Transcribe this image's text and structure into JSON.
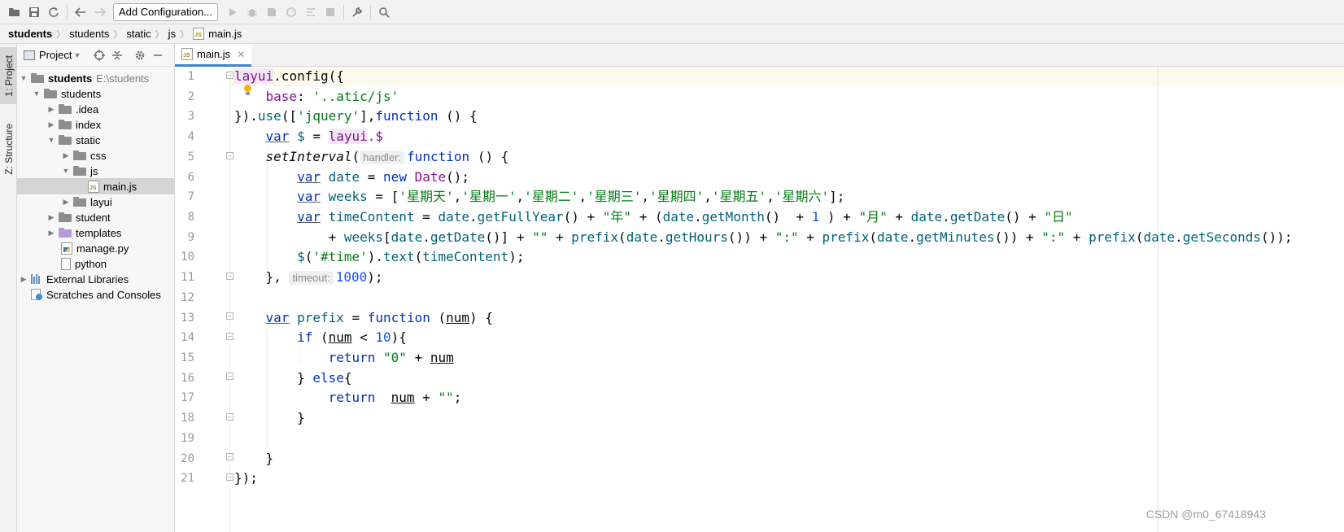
{
  "toolbar": {
    "config_label": "Add Configuration...",
    "icons": [
      "open-folder-icon",
      "save-icon",
      "sync-icon",
      "back-icon",
      "forward-icon",
      "run-icon",
      "debug-icon",
      "coverage-icon",
      "profile-icon",
      "concurrency-icon",
      "stop-icon",
      "settings-wrench-icon",
      "search-icon"
    ]
  },
  "breadcrumb": [
    "students",
    "students",
    "static",
    "js",
    "main.js"
  ],
  "side_tabs": {
    "project": "1: Project",
    "structure": "Z: Structure"
  },
  "project_panel": {
    "title": "Project",
    "tree": [
      {
        "label": "students",
        "note": "E:\\students",
        "level": 0,
        "expanded": true,
        "kind": "folder-root"
      },
      {
        "label": "students",
        "level": 1,
        "expanded": true,
        "kind": "folder"
      },
      {
        "label": ".idea",
        "level": 2,
        "expanded": false,
        "kind": "folder"
      },
      {
        "label": "index",
        "level": 2,
        "expanded": false,
        "kind": "folder"
      },
      {
        "label": "static",
        "level": 2,
        "expanded": true,
        "kind": "folder"
      },
      {
        "label": "css",
        "level": 3,
        "expanded": false,
        "kind": "folder"
      },
      {
        "label": "js",
        "level": 3,
        "expanded": true,
        "kind": "folder"
      },
      {
        "label": "main.js",
        "level": 4,
        "kind": "js-file",
        "selected": true
      },
      {
        "label": "layui",
        "level": 3,
        "expanded": false,
        "kind": "folder"
      },
      {
        "label": "student",
        "level": 2,
        "expanded": false,
        "kind": "folder"
      },
      {
        "label": "templates",
        "level": 2,
        "expanded": false,
        "kind": "folder-purple"
      },
      {
        "label": "manage.py",
        "level": 2,
        "kind": "py-file"
      },
      {
        "label": "python",
        "level": 2,
        "kind": "plain-file"
      },
      {
        "label": "External Libraries",
        "level": 0,
        "expanded": false,
        "kind": "libraries"
      },
      {
        "label": "Scratches and Consoles",
        "level": 0,
        "kind": "scratches"
      }
    ]
  },
  "editor": {
    "tab_label": "main.js",
    "line_numbers": [
      "1",
      "2",
      "3",
      "4",
      "5",
      "6",
      "7",
      "8",
      "9",
      "10",
      "11",
      "12",
      "13",
      "14",
      "15",
      "16",
      "17",
      "18",
      "19",
      "20",
      "21"
    ],
    "code": {
      "l1": [
        "layui",
        ".config({"
      ],
      "l2": [
        "base",
        ": ",
        "'..atic/js'"
      ],
      "l3": [
        "}).",
        "use",
        "([",
        "'jquery'",
        "],",
        "function",
        " () {"
      ],
      "l4": [
        "var",
        " ",
        "$",
        " = ",
        "layui",
        ".$"
      ],
      "l5": [
        "setInterval",
        "(",
        "handler:",
        "function",
        " () {"
      ],
      "l6": [
        "var",
        " ",
        "date",
        " = ",
        "new",
        " ",
        "Date",
        "();"
      ],
      "l7": [
        "var",
        " ",
        "weeks",
        " = [",
        "'星期天'",
        ",",
        "'星期一'",
        ",",
        "'星期二'",
        ",",
        "'星期三'",
        ",",
        "'星期四'",
        ",",
        "'星期五'",
        ",",
        "'星期六'",
        "];"
      ],
      "l8": [
        "var",
        " ",
        "timeContent",
        " = ",
        "date",
        ".",
        "getFullYear",
        "() + ",
        "\"年\"",
        " + (",
        "date",
        ".",
        "getMonth",
        "()  + ",
        "1",
        " ) + ",
        "\"月\"",
        " + ",
        "date",
        ".",
        "getDate",
        "() + ",
        "\"日\""
      ],
      "l9": [
        "+ ",
        "weeks",
        "[",
        "date",
        ".",
        "getDate",
        "()] + ",
        "\"\"",
        " + ",
        "prefix",
        "(",
        "date",
        ".",
        "getHours",
        "()) + ",
        "\":\"",
        " + ",
        "prefix",
        "(",
        "date",
        ".",
        "getMinutes",
        "()) + ",
        "\":\"",
        " + ",
        "prefix",
        "(",
        "date",
        ".",
        "getSeconds",
        "());"
      ],
      "l10": [
        "$",
        "(",
        "'#time'",
        ").",
        "text",
        "(",
        "timeContent",
        ");"
      ],
      "l11": [
        "}, ",
        "timeout:",
        "1000",
        ");"
      ],
      "l13": [
        "var",
        " ",
        "prefix",
        " = ",
        "function",
        " (",
        "num",
        ") {"
      ],
      "l14": [
        "if",
        " (",
        "num",
        " < ",
        "10",
        "){"
      ],
      "l15": [
        "return",
        " ",
        "\"0\"",
        " + ",
        "num"
      ],
      "l16": [
        "} ",
        "else",
        "{"
      ],
      "l17": [
        "return",
        "  ",
        "num",
        " + ",
        "\"\"",
        ";"
      ],
      "l18": [
        "}"
      ],
      "l20": [
        "}"
      ],
      "l21": [
        "});"
      ]
    }
  },
  "watermark": "CSDN @m0_67418943",
  "colors": {
    "keyword": "#0033b3",
    "string": "#067d17",
    "number": "#1750eb",
    "function_call": "#00627a",
    "global": "#871094",
    "tab_underline": "#4083c9"
  }
}
